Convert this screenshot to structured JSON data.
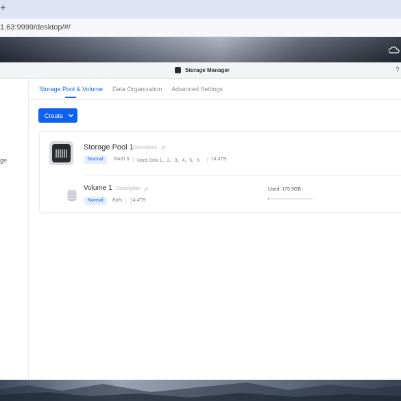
{
  "browser": {
    "new_tab_symbol": "+",
    "url": "1.63:9999/desktop/#/"
  },
  "window": {
    "title": "Storage Manager",
    "help_symbol": "?"
  },
  "sidebar": {
    "partial_label": "ge"
  },
  "tabs": [
    {
      "label": "Storage Pool & Volume",
      "active": true
    },
    {
      "label": "Data Organization",
      "active": false
    },
    {
      "label": "Advanced Settings",
      "active": false
    }
  ],
  "toolbar": {
    "create_label": "Create"
  },
  "pool": {
    "title": "Storage Pool 1",
    "description_placeholder": "Description",
    "status": "Normal",
    "raid": "RAID 6",
    "disks": "Hard Disk 1、2、3、4、5、6",
    "capacity": "14.4TB",
    "icon": "storage-pool-icon"
  },
  "volume": {
    "title": "Volume 1",
    "description_placeholder": "Description",
    "status": "Normal",
    "filesystem": "Btrfs",
    "capacity": "14.4TB",
    "used_label": "Used: 175.9GB",
    "used_fraction": 0.012,
    "icon": "volume-icon"
  },
  "colors": {
    "accent": "#1a66e6",
    "button": "#1061f0",
    "badge_bg": "#e4eefe"
  }
}
